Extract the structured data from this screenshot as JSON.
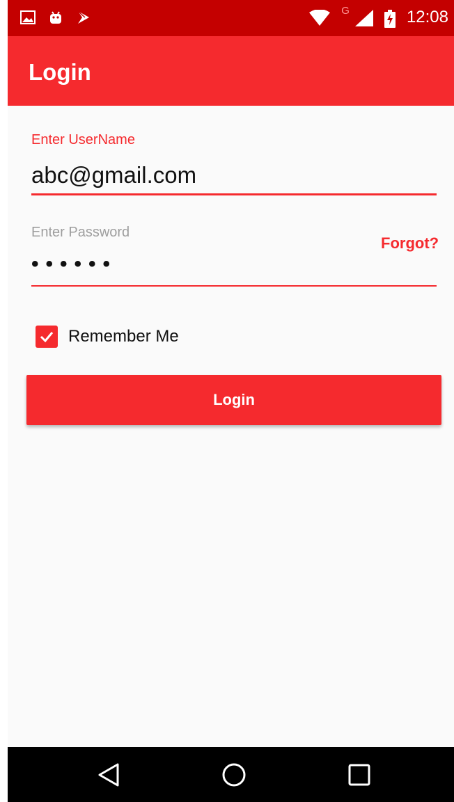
{
  "status_bar": {
    "time": "12:08",
    "network_type": "G",
    "left_icons": [
      "gallery-icon",
      "android-icon",
      "play-store-icon"
    ],
    "right_icons": [
      "wifi-icon",
      "signal-icon",
      "battery-charging-icon"
    ]
  },
  "app_bar": {
    "title": "Login"
  },
  "form": {
    "username_label": "Enter UserName",
    "username_value": "abc@gmail.com",
    "password_label": "Enter Password",
    "password_value": "••••••",
    "forgot_label": "Forgot?",
    "remember_label": "Remember Me",
    "remember_checked": true,
    "login_label": "Login"
  },
  "nav_bar": {
    "buttons": [
      "back-icon",
      "home-icon",
      "recents-icon"
    ]
  },
  "colors": {
    "accent": "#f52a2e",
    "status_bar": "#c40000",
    "background": "#fafafa",
    "hint": "#9e9e9e"
  }
}
